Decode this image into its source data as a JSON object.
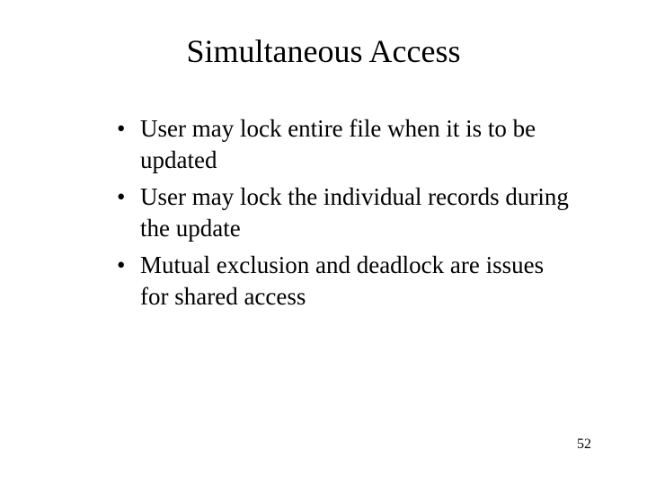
{
  "title": "Simultaneous Access",
  "bullets": [
    "User may lock entire file when it is to be updated",
    "User may lock the individual records during the update",
    "Mutual exclusion and deadlock are issues for shared access"
  ],
  "page_number": "52"
}
